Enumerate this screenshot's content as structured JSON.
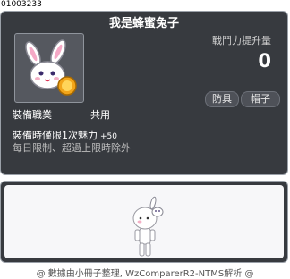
{
  "item_id": "01003233",
  "item_name": "我是蜂蜜兔子",
  "power_label": "戰鬥力提升量",
  "power_value": "0",
  "tags": [
    "防具",
    "帽子"
  ],
  "job_label": "裝備職業",
  "job_value": "共用",
  "desc_line1": "裝備時僅限1次魅力",
  "desc_stat": "+50",
  "desc_line2": "每日限制、超過上限時除外",
  "icons": {
    "item": "rabbit-hat-icon",
    "preview": "character-preview"
  },
  "colors": {
    "panel_bg": "#373a3f",
    "panel_border": "#9aa0a8",
    "preview_bg": "#f7f7f9"
  },
  "footer": "@ 數據由小冊子整理, WzComparerR2-NTMS解析 @"
}
